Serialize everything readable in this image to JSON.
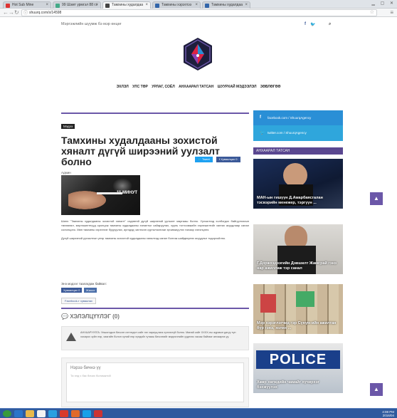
{
  "browser": {
    "tabs": [
      {
        "label": "Hot Sub Mine",
        "active": false
      },
      {
        "label": "99 Шэмт урмгэл 88 гэ",
        "active": false
      },
      {
        "label": "Тамхины худалдаа",
        "active": true
      },
      {
        "label": "Тамхины хэрэглээ",
        "active": false
      },
      {
        "label": "Тамхины худалдаа",
        "active": false
      }
    ],
    "url": "shuurq.com/s/14598"
  },
  "site": {
    "tagline": "Мэргэжлийн шуумж бэ мэр өнцөг",
    "nav": [
      "ЭХЛЭЛ",
      "УЛС ТӨР",
      "УРЛАГ, СОЁЛ",
      "АНХААРАЛ ТАТСАН",
      "ШУУРХАЙ МЭДЭЭЛЭЛ",
      "ЗӨВЛӨГӨӨ"
    ]
  },
  "article": {
    "category": "Мэдээ",
    "title": "Тамхины худалдааны зохистой хяналт дүгүй ширээний уулзалт болно",
    "author": "Админ",
    "date": "1 цаг",
    "tweet": "Tweet",
    "fb": "Хуваалцах 0",
    "photo_caption": "11 МИНУТ",
    "body1": "Шинэ \"Тамхины худалдааны зохистой хяналт\" сэдэвтэй дүгүй ширээний уулзалт маргааш болно. Уулзалтад холбогдох байгууллагын төлөөлөл, мэргэжилтнүүд оролцож тамхины худалдааны хяналтыг сайжруулах, хууль тогтоомжийн хэрэгжилтийг хангах асуудлаар санал солилцоно. Мөн тамхины хэрэглээг бууруулах, иргэдэд чиглэсэн сурталчилгааг эрчимжүүлэх талаар хэлэлцэнэ.",
    "body2": "Дүгүй ширээний уулзалтын үеэр тамхины зохистой худалдааны хяналтад санал болгож шийдвэрлэх асуудлыг тодорхойлно.",
    "like_text": "Энэ мэдээг таалагдаж байвал:",
    "btn_share": "Хуваалцах 0",
    "btn_like": "Жиоох",
    "fb_share": "Facebook-т хуваалах"
  },
  "comments": {
    "title": "ХЭЛЭЛЦҮҮЛЭГ (0)",
    "warning": "АНХААРУУЛГА: Уншигчдын бичсэн сэтгэгдэл сайт нэг хариуцлага хүлээхгүй болно. Манай сайт XXXX-ны журмын дагуу хүн хохирох зүйл нэр, хаягийн болон хүний нэр хүндийг гутааж бичсэнийг мэдээллийн үүднээс хасаж байгааг анхаарна уу.",
    "placeholder": "Нэрээ бичнэ үү",
    "placeholder2": "Та энд ч бас бичих боломжтой"
  },
  "sidebar": {
    "facebook": "facebook.com / ShuurqAgency",
    "twitter": "twitter.com / ShuurqAgency",
    "widget_title": "АНХААРАЛ ТАТСАН",
    "cards": [
      "МАН-ын гишүүн Д.Амарбаясгалан тэсвэрийн менежер, тэргүүн ...",
      "Г.Доржхэдээгийн Дэвшилт Жамсрай гэнэ нар ажиллаж тэр санал",
      "Мэр хэрэглэгчид гэр Сүнүм-ийн ажилтан бүр гэнэ, холих ...",
      "Хөөр хөгждийн чамайг хүчирхэг бэхжүүлэх"
    ]
  },
  "taskbar": {
    "time": "4:08 PM",
    "date": "2016/04"
  }
}
